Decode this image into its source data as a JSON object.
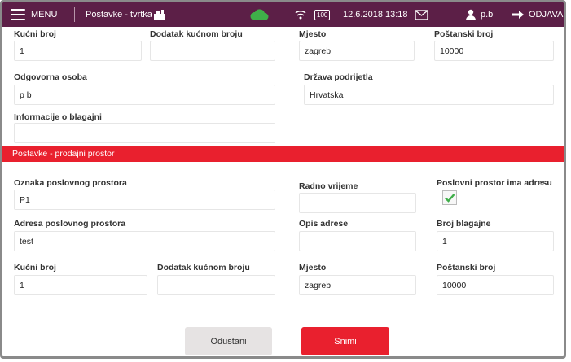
{
  "header": {
    "menu_label": "MENU",
    "screen_title": "Postavke - tvrtka",
    "battery": "100",
    "datetime": "12.6.2018 13:18",
    "user": "p.b",
    "logout_label": "ODJAVA",
    "cloud_color": "#3fae49"
  },
  "company": {
    "house_number_label": "Kućni broj",
    "house_number": "1",
    "addition_label": "Dodatak kućnom broju",
    "addition": "",
    "city_label": "Mjesto",
    "city": "zagreb",
    "postal_label": "Poštanski broj",
    "postal": "10000",
    "responsible_label": "Odgovorna osoba",
    "responsible": "p b",
    "country_label": "Država podrijetla",
    "country": "Hrvatska",
    "register_info_label": "Informacije o blagajni",
    "register_info": ""
  },
  "section_title": "Postavke - prodajni prostor",
  "premises": {
    "code_label": "Oznaka poslovnog prostora",
    "code": "P1",
    "hours_label": "Radno vrijeme",
    "hours": "",
    "has_address_label": "Poslovni prostor ima adresu",
    "has_address": true,
    "address_label": "Adresa poslovnog prostora",
    "address": "test",
    "address_desc_label": "Opis adrese",
    "address_desc": "",
    "register_no_label": "Broj blagajne",
    "register_no": "1",
    "house_number_label": "Kućni broj",
    "house_number": "1",
    "addition_label": "Dodatak kućnom broju",
    "addition": "",
    "city_label": "Mjesto",
    "city": "zagreb",
    "postal_label": "Poštanski broj",
    "postal": "10000"
  },
  "actions": {
    "cancel_label": "Odustani",
    "save_label": "Snimi",
    "save_color": "#e9202e"
  }
}
